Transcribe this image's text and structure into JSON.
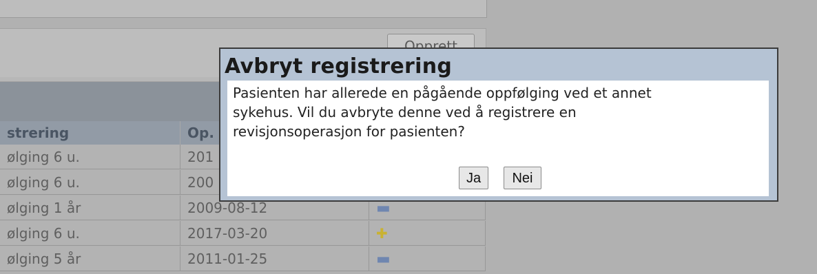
{
  "background": {
    "create_button_label": "Opprett"
  },
  "table": {
    "columns": [
      "strering",
      "Op."
    ],
    "rows": [
      {
        "type": "ølging 6 u.",
        "date": "201",
        "status": ""
      },
      {
        "type": "ølging 6 u.",
        "date": "200",
        "status": ""
      },
      {
        "type": "ølging 1 år",
        "date": "2009-08-12",
        "status": "minus"
      },
      {
        "type": "ølging 6 u.",
        "date": "2017-03-20",
        "status": "plus"
      },
      {
        "type": "ølging 5 år",
        "date": "2011-01-25",
        "status": "minus"
      }
    ]
  },
  "dialog": {
    "title": "Avbryt registrering",
    "message_lines": [
      "Pasienten har allerede en pågående oppfølging ved et annet",
      "sykehus. Vil du avbryte denne ved å registrere en",
      "revisjonsoperasjon for pasienten?"
    ],
    "yes_label": "Ja",
    "no_label": "Nei"
  },
  "icons": {
    "minus": "minus-icon",
    "plus": "plus-icon"
  },
  "colors": {
    "dialog_header": "#b5c3d4",
    "dialog_border": "#3a3a3a",
    "overlay": "#b1b1b1"
  }
}
